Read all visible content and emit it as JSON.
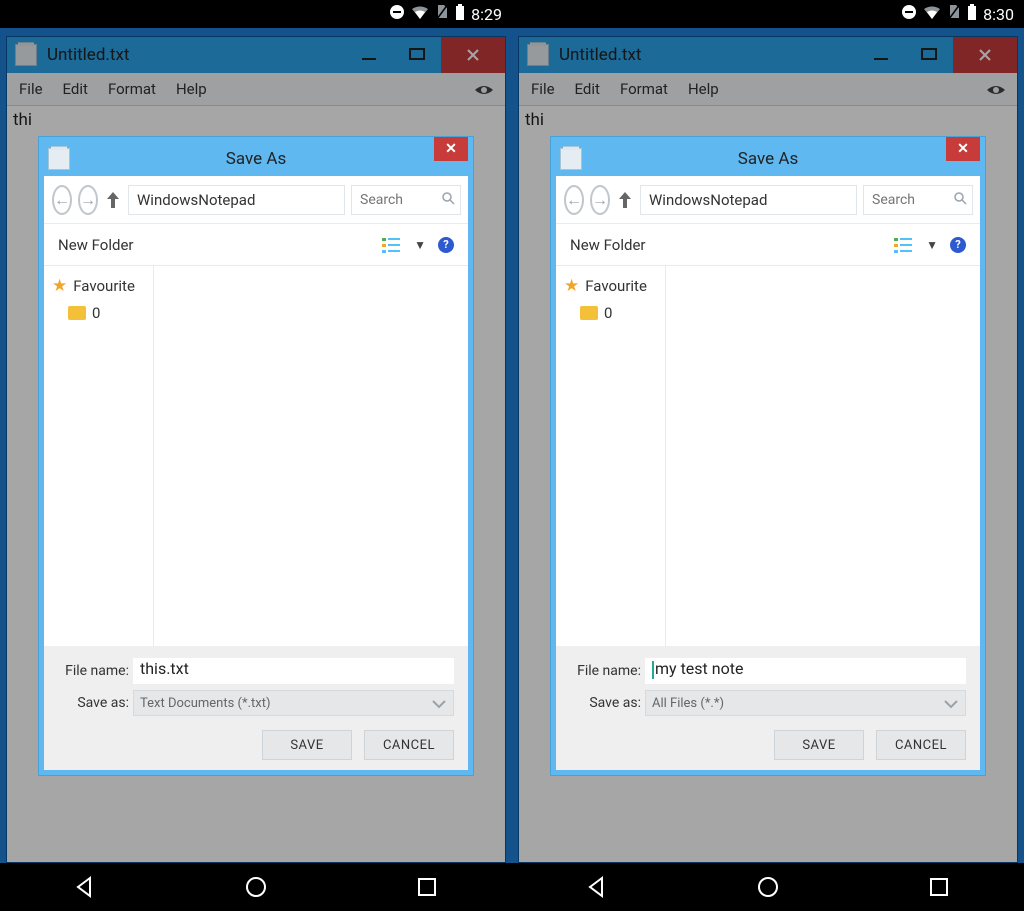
{
  "left": {
    "status_time": "8:29",
    "window_title": "Untitled.txt",
    "menu": {
      "file": "File",
      "edit": "Edit",
      "format": "Format",
      "help": "Help"
    },
    "editor_text": "thi",
    "dialog": {
      "title": "Save As",
      "path": "WindowsNotepad",
      "search_placeholder": "Search",
      "new_folder": "New Folder",
      "sidebar": {
        "favourite": "Favourite",
        "folder0": "0"
      },
      "filename_label": "File name:",
      "filename": "this.txt",
      "saveas_label": "Save as:",
      "saveas_value": "Text Documents (*.txt)",
      "save_btn": "SAVE",
      "cancel_btn": "CANCEL",
      "show_cursor": false
    }
  },
  "right": {
    "status_time": "8:30",
    "window_title": "Untitled.txt",
    "menu": {
      "file": "File",
      "edit": "Edit",
      "format": "Format",
      "help": "Help"
    },
    "editor_text": "thi",
    "dialog": {
      "title": "Save As",
      "path": "WindowsNotepad",
      "search_placeholder": "Search",
      "new_folder": "New Folder",
      "sidebar": {
        "favourite": "Favourite",
        "folder0": "0"
      },
      "filename_label": "File name:",
      "filename": "my test note",
      "saveas_label": "Save as:",
      "saveas_value": "All Files (*.*)",
      "save_btn": "SAVE",
      "cancel_btn": "CANCEL",
      "show_cursor": true
    }
  }
}
